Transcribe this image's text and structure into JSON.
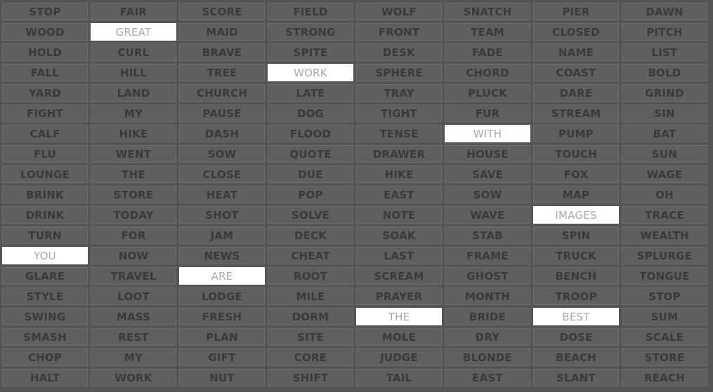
{
  "colors": {
    "board_background": "#555555",
    "cell_background": "#5f5f5f",
    "cell_text": "#3a3a3a",
    "selected_background": "#ffffff",
    "selected_text": "#a8a8a8"
  },
  "grid": {
    "columns": 8,
    "rows": [
      [
        "STOP",
        "FAIR",
        "SCORE",
        "FIELD",
        "WOLF",
        "SNATCH",
        "PIER",
        "DAWN"
      ],
      [
        "WOOD",
        "GREAT",
        "MAID",
        "STRONG",
        "FRONT",
        "TEAM",
        "CLOSED",
        "PITCH"
      ],
      [
        "HOLD",
        "CURL",
        "BRAVE",
        "SPITE",
        "DESK",
        "FADE",
        "NAME",
        "LIST"
      ],
      [
        "FALL",
        "HILL",
        "TREE",
        "WORK",
        "SPHERE",
        "CHORD",
        "COAST",
        "BOLD"
      ],
      [
        "YARD",
        "LAND",
        "CHURCH",
        "LATE",
        "TRAY",
        "PLUCK",
        "DARE",
        "GRIND"
      ],
      [
        "FIGHT",
        "MY",
        "PAUSE",
        "DOG",
        "TIGHT",
        "FUR",
        "STREAM",
        "SIN"
      ],
      [
        "CALF",
        "HIKE",
        "DASH",
        "FLOOD",
        "TENSE",
        "WITH",
        "PUMP",
        "BAT"
      ],
      [
        "FLU",
        "WENT",
        "SOW",
        "QUOTE",
        "DRAWER",
        "HOUSE",
        "TOUCH",
        "SUN"
      ],
      [
        "LOUNGE",
        "THE",
        "CLOSE",
        "DUE",
        "HIKE",
        "SAVE",
        "FOX",
        "WAGE"
      ],
      [
        "BRINK",
        "STORE",
        "HEAT",
        "POP",
        "EAST",
        "SOW",
        "MAP",
        "OH"
      ],
      [
        "DRINK",
        "TODAY",
        "SHOT",
        "SOLVE",
        "NOTE",
        "WAVE",
        "IMAGES",
        "TRACE"
      ],
      [
        "TURN",
        "FOR",
        "JAM",
        "DECK",
        "SOAK",
        "STAB",
        "SPIN",
        "WEALTH"
      ],
      [
        "YOU",
        "NOW",
        "NEWS",
        "CHEAT",
        "LAST",
        "FRAME",
        "TRUCK",
        "SPLURGE"
      ],
      [
        "GLARE",
        "TRAVEL",
        "ARE",
        "ROOT",
        "SCREAM",
        "GHOST",
        "BENCH",
        "TONGUE"
      ],
      [
        "STYLE",
        "LOOT",
        "LODGE",
        "MILE",
        "PRAYER",
        "MONTH",
        "TROOP",
        "STOP"
      ],
      [
        "SWING",
        "MASS",
        "FRESH",
        "DORM",
        "THE",
        "BRIDE",
        "BEST",
        "SUM"
      ],
      [
        "SMASH",
        "REST",
        "PLAN",
        "SITE",
        "MOLE",
        "DRY",
        "DOSE",
        "SCALE"
      ],
      [
        "CHOP",
        "MY",
        "GIFT",
        "CORE",
        "JUDGE",
        "BLONDE",
        "BEACH",
        "STORE"
      ],
      [
        "HALT",
        "WORK",
        "NUT",
        "SHIFT",
        "TAIL",
        "EAST",
        "SLANT",
        "REACH"
      ]
    ],
    "selected_cells": [
      [
        1,
        1
      ],
      [
        3,
        3
      ],
      [
        6,
        5
      ],
      [
        10,
        6
      ],
      [
        12,
        0
      ],
      [
        13,
        2
      ],
      [
        15,
        4
      ],
      [
        15,
        6
      ]
    ]
  }
}
